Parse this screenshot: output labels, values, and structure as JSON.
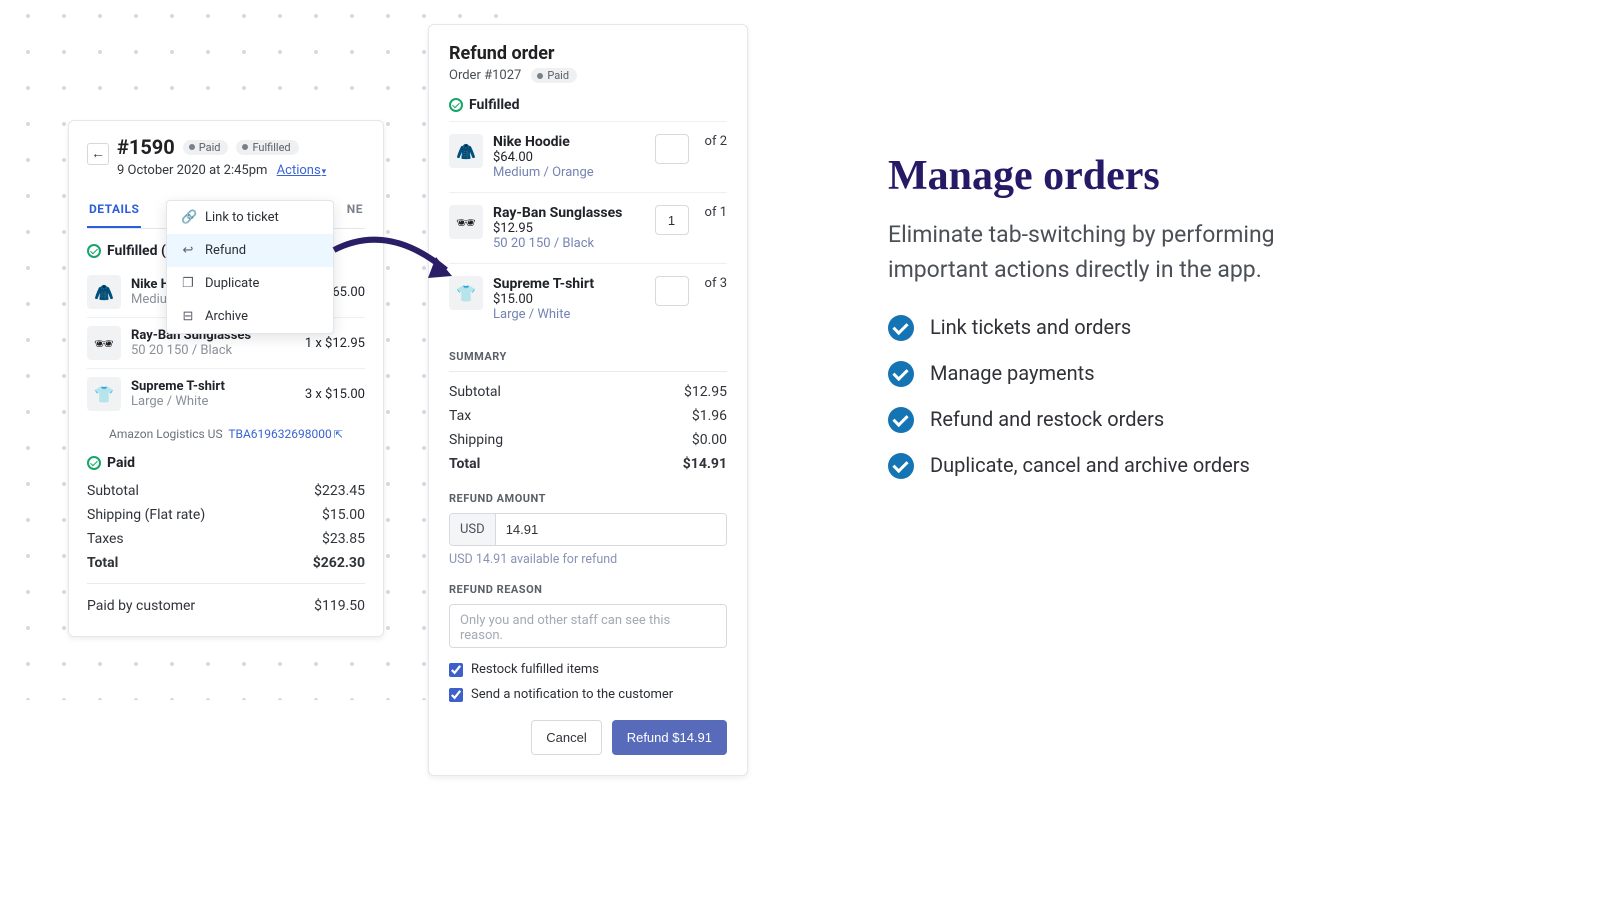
{
  "card1": {
    "back": "←",
    "orderNumber": "#1590",
    "badgePaid": "Paid",
    "badgeFulfilled": "Fulfilled",
    "date": "9 October 2020 at 2:45pm",
    "actions": "Actions",
    "tabs": {
      "details": "DETAILS",
      "timeline": "NE"
    },
    "fulfilled": "Fulfilled (6)",
    "items": [
      {
        "name": "Nike Ho",
        "variant": "Mediun",
        "qty": "65.00",
        "thumb": "🧥"
      },
      {
        "name": "Ray-Ban Sunglasses",
        "variant": "50 20 150 / Black",
        "qty": "1 x $12.95",
        "thumb": "🕶"
      },
      {
        "name": "Supreme T-shirt",
        "variant": "Large / White",
        "qty": "3 x $15.00",
        "thumb": "👕"
      }
    ],
    "trackingCarrier": "Amazon Logistics US",
    "trackingNumber": "TBA619632698000",
    "paid": "Paid",
    "subtotal_label": "Subtotal",
    "subtotal": "$223.45",
    "shipping_label": "Shipping (Flat rate)",
    "shipping": "$15.00",
    "taxes_label": "Taxes",
    "taxes": "$23.85",
    "total_label": "Total",
    "total": "$262.30",
    "paidby_label": "Paid by customer",
    "paidby": "$119.50"
  },
  "dropdown": {
    "link": "Link to ticket",
    "refund": "Refund",
    "duplicate": "Duplicate",
    "archive": "Archive"
  },
  "card2": {
    "title": "Refund order",
    "sub": "Order #1027",
    "badge": "Paid",
    "fulfilled": "Fulfilled",
    "items": [
      {
        "name": "Nike Hoodie",
        "price": "$64.00",
        "variant": "Medium / Orange",
        "qty": "",
        "of": "of 2",
        "thumb": "🧥"
      },
      {
        "name": "Ray-Ban Sunglasses",
        "price": "$12.95",
        "variant": "50 20 150 / Black",
        "qty": "1",
        "of": "of 1",
        "thumb": "🕶"
      },
      {
        "name": "Supreme T-shirt",
        "price": "$15.00",
        "variant": "Large / White",
        "qty": "",
        "of": "of 3",
        "thumb": "👕"
      }
    ],
    "summaryHead": "SUMMARY",
    "subtotal_label": "Subtotal",
    "subtotal": "$12.95",
    "tax_label": "Tax",
    "tax": "$1.96",
    "shipping_label": "Shipping",
    "shipping": "$0.00",
    "total_label": "Total",
    "total": "$14.91",
    "refundAmountHead": "REFUND AMOUNT",
    "currency": "USD",
    "amount": "14.91",
    "hint": "USD 14.91 available for refund",
    "reasonHead": "REFUND REASON",
    "reasonPlaceholder": "Only you and other staff can see this reason.",
    "restock": "Restock fulfilled items",
    "notify": "Send a notification to the customer",
    "cancel": "Cancel",
    "confirm": "Refund $14.91"
  },
  "marketing": {
    "title": "Manage orders",
    "subtitle": "Eliminate tab-switching by performing important actions directly in the app.",
    "features": [
      "Link tickets and orders",
      "Manage payments",
      "Refund and restock orders",
      "Duplicate, cancel and archive orders"
    ]
  }
}
